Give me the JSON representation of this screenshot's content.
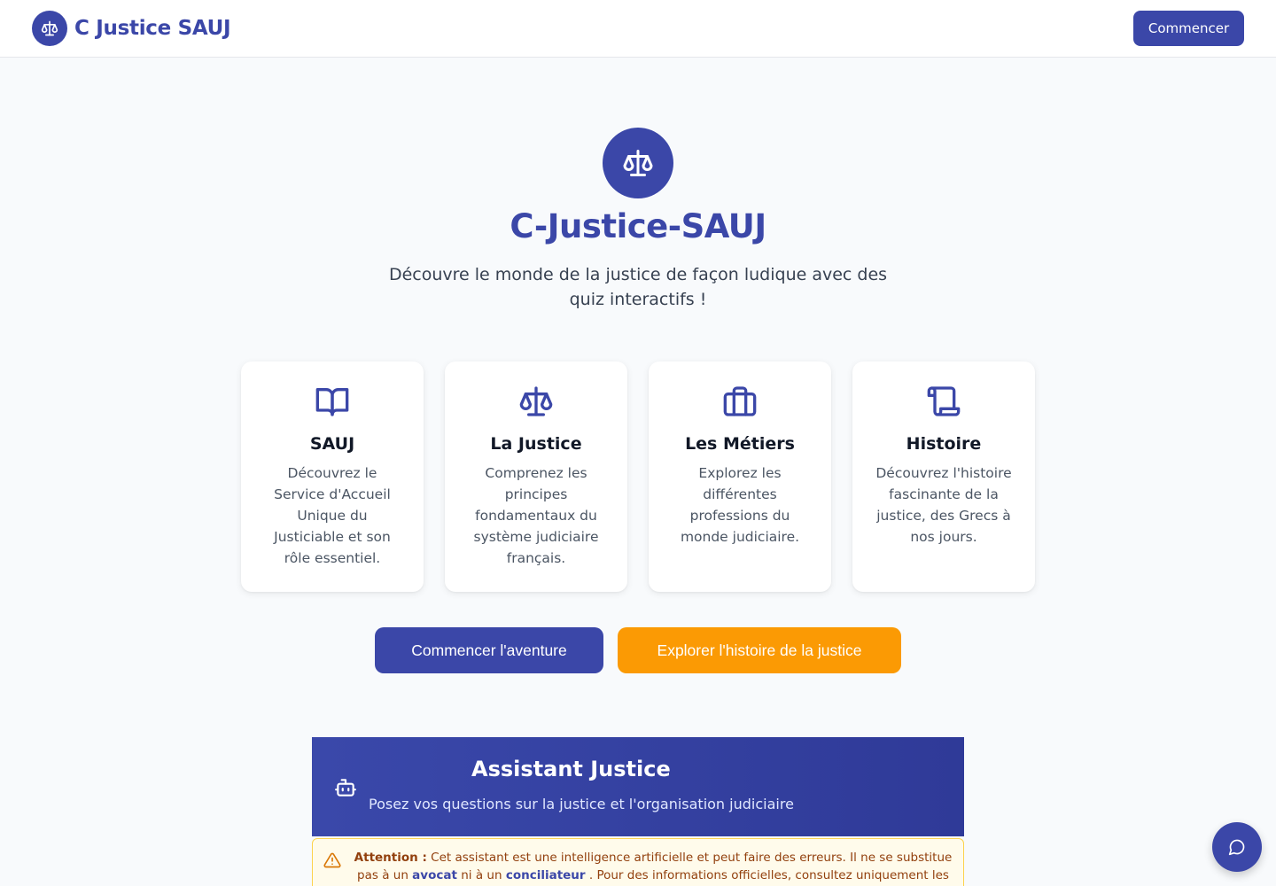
{
  "header": {
    "brand": "C Justice SAUJ",
    "start_button": "Commencer"
  },
  "hero": {
    "title": "C-Justice-SAUJ",
    "subtitle": "Découvre le monde de la justice de façon ludique avec des quiz interactifs !"
  },
  "cards": [
    {
      "icon": "book-icon",
      "title": "SAUJ",
      "text": "Découvrez le Service d'Accueil Unique du Justiciable et son rôle essentiel."
    },
    {
      "icon": "scales-icon",
      "title": "La Justice",
      "text": "Comprenez les principes fondamentaux du système judiciaire français."
    },
    {
      "icon": "briefcase-icon",
      "title": "Les Métiers",
      "text": "Explorez les différentes professions du monde judiciaire."
    },
    {
      "icon": "scroll-icon",
      "title": "Histoire",
      "text": "Découvrez l'histoire fascinante de la justice, des Grecs à nos jours."
    }
  ],
  "cta": {
    "primary": "Commencer l'aventure",
    "secondary": "Explorer l'histoire de la justice"
  },
  "assistant": {
    "title": "Assistant Justice",
    "subtitle": "Posez vos questions sur la justice et l'organisation judiciaire",
    "warning_label": "Attention :",
    "warning_part1": "Cet assistant est une intelligence artificielle et peut faire des erreurs. Il ne se substitue pas à un",
    "warning_link1": "avocat",
    "warning_part2": "ni à un",
    "warning_link2": "conciliateur",
    "warning_part3": ". Pour des informations officielles, consultez uniquement les sources"
  },
  "colors": {
    "primary": "#3b47a8",
    "accent": "#fb9a04",
    "background": "#f8fafc"
  }
}
